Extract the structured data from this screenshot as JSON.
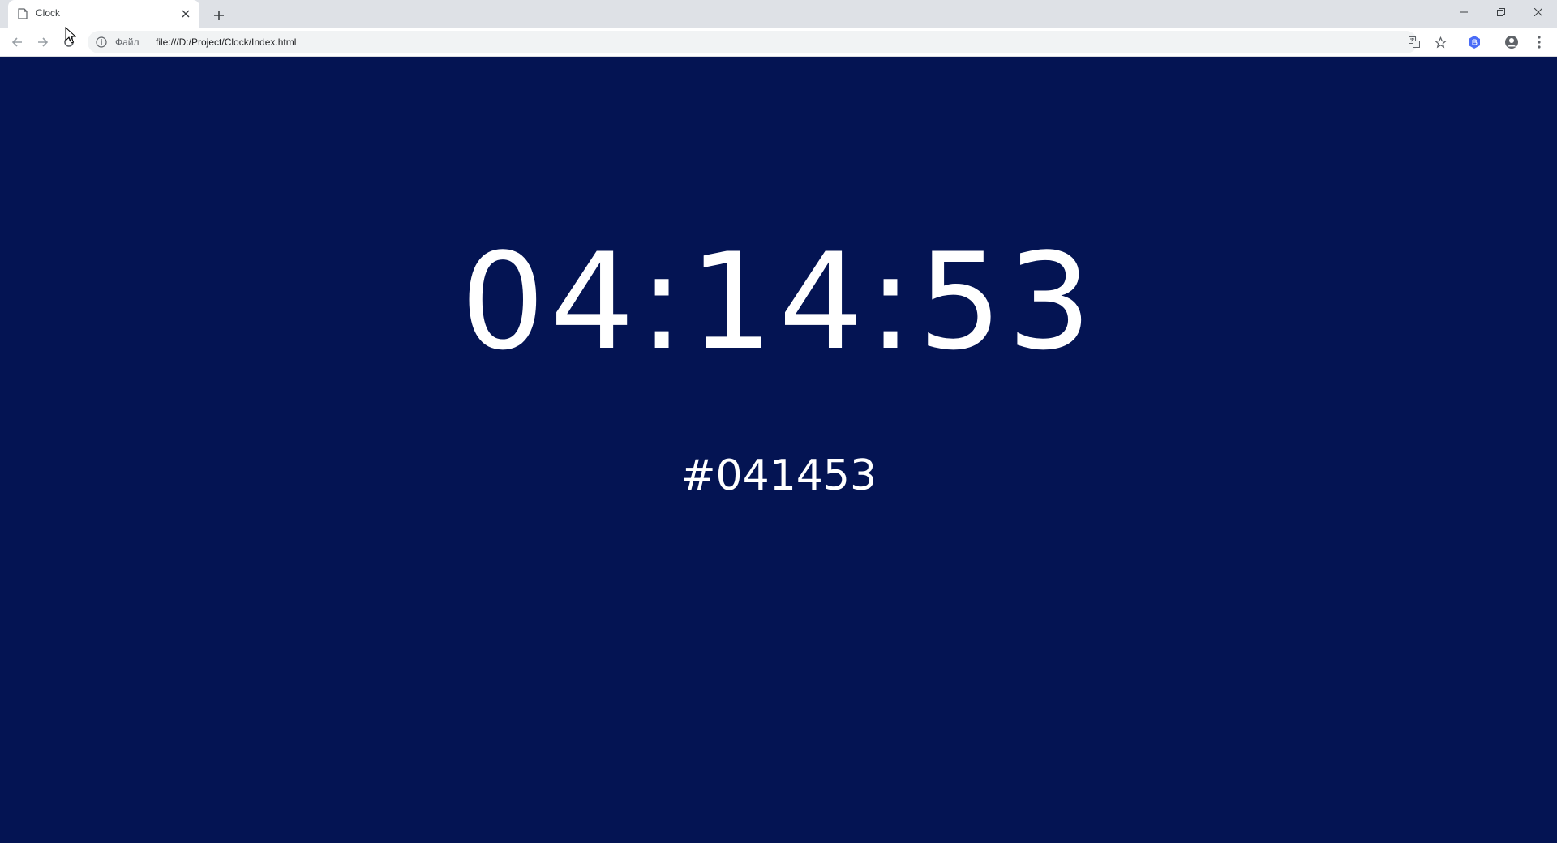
{
  "browser": {
    "tab": {
      "title": "Clock",
      "favicon": "page-icon"
    },
    "omnibox": {
      "scheme_label": "Файл",
      "url": "file:///D:/Project/Clock/Index.html"
    },
    "icons": [
      "back-icon",
      "forward-icon",
      "reload-icon",
      "info-icon",
      "translate-icon",
      "star-icon",
      "extension-icon",
      "profile-icon",
      "menu-icon",
      "minimize-icon",
      "restore-icon",
      "close-icon",
      "new-tab-icon"
    ]
  },
  "page": {
    "time": "04:14:53",
    "hex_color": "#041453",
    "background": "#041453",
    "text_color": "#ffffff"
  }
}
